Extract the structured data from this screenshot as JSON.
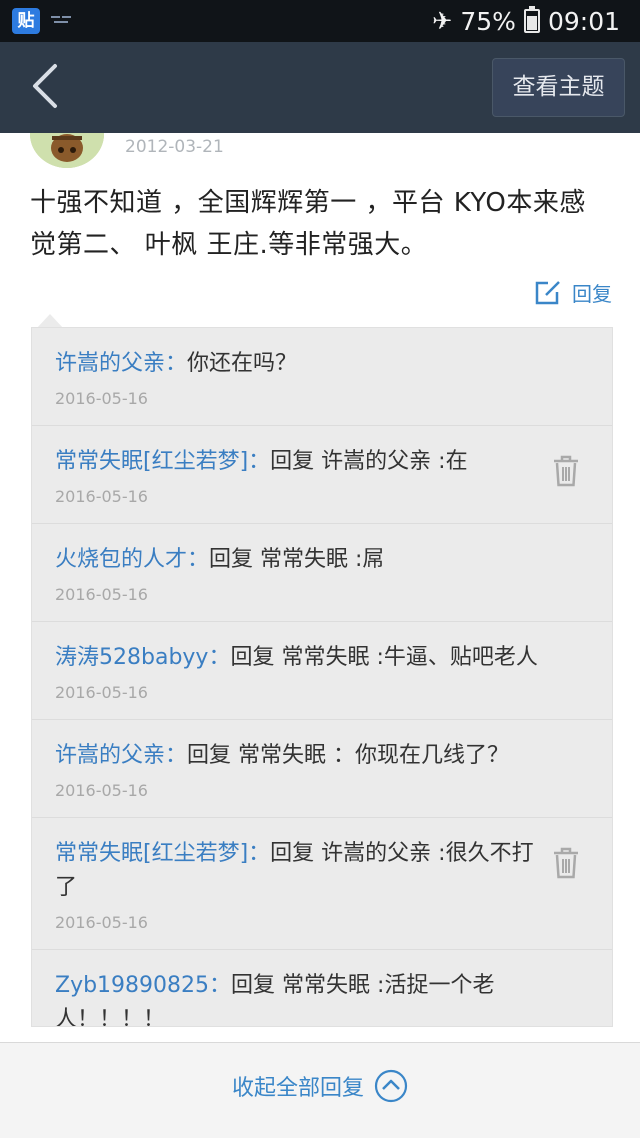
{
  "status_bar": {
    "app_icon_text": "贴",
    "battery": "75%",
    "time": "09:01"
  },
  "nav": {
    "view_topic_label": "查看主题"
  },
  "post": {
    "date": "2012-03-21",
    "content": "十强不知道 ，全国辉辉第一 ，平台 KYO本来感觉第二、 叶枫 王庄.等非常强大。",
    "reply_label": "回复"
  },
  "sub_replies": [
    {
      "user": "许嵩的父亲：",
      "text": "你还在吗？",
      "date": "2016-05-16",
      "deletable": false
    },
    {
      "user": "常常失眠[红尘若梦]：",
      "text": "回复 许嵩的父亲 :在",
      "date": "2016-05-16",
      "deletable": true
    },
    {
      "user": "火烧包的人才：",
      "text": "回复 常常失眠 :屌",
      "date": "2016-05-16",
      "deletable": false
    },
    {
      "user": "涛涛528babyy：",
      "text": "回复 常常失眠 :牛逼、贴吧老人",
      "date": "2016-05-16",
      "deletable": false
    },
    {
      "user": "许嵩的父亲：",
      "text": "回复 常常失眠 ：你现在几线了？",
      "date": "2016-05-16",
      "deletable": false
    },
    {
      "user": "常常失眠[红尘若梦]：",
      "text": "回复 许嵩的父亲 :很久不打了",
      "date": "2016-05-16",
      "deletable": true
    },
    {
      "user": "Zyb19890825：",
      "text": "回复 常常失眠 :活捉一个老人！！！！",
      "date": "",
      "deletable": false
    }
  ],
  "bottom": {
    "collapse_label": "收起全部回复"
  },
  "colors": {
    "nav_bg": "#2e3a48",
    "link_blue": "#3a86c8",
    "user_blue": "#3a7ec2",
    "sub_bg": "#ebebeb"
  },
  "icons": [
    "app-icon",
    "airplane-icon",
    "battery-icon",
    "back-arrow-icon",
    "edit-icon",
    "trash-icon",
    "chevron-up-circle-icon"
  ]
}
